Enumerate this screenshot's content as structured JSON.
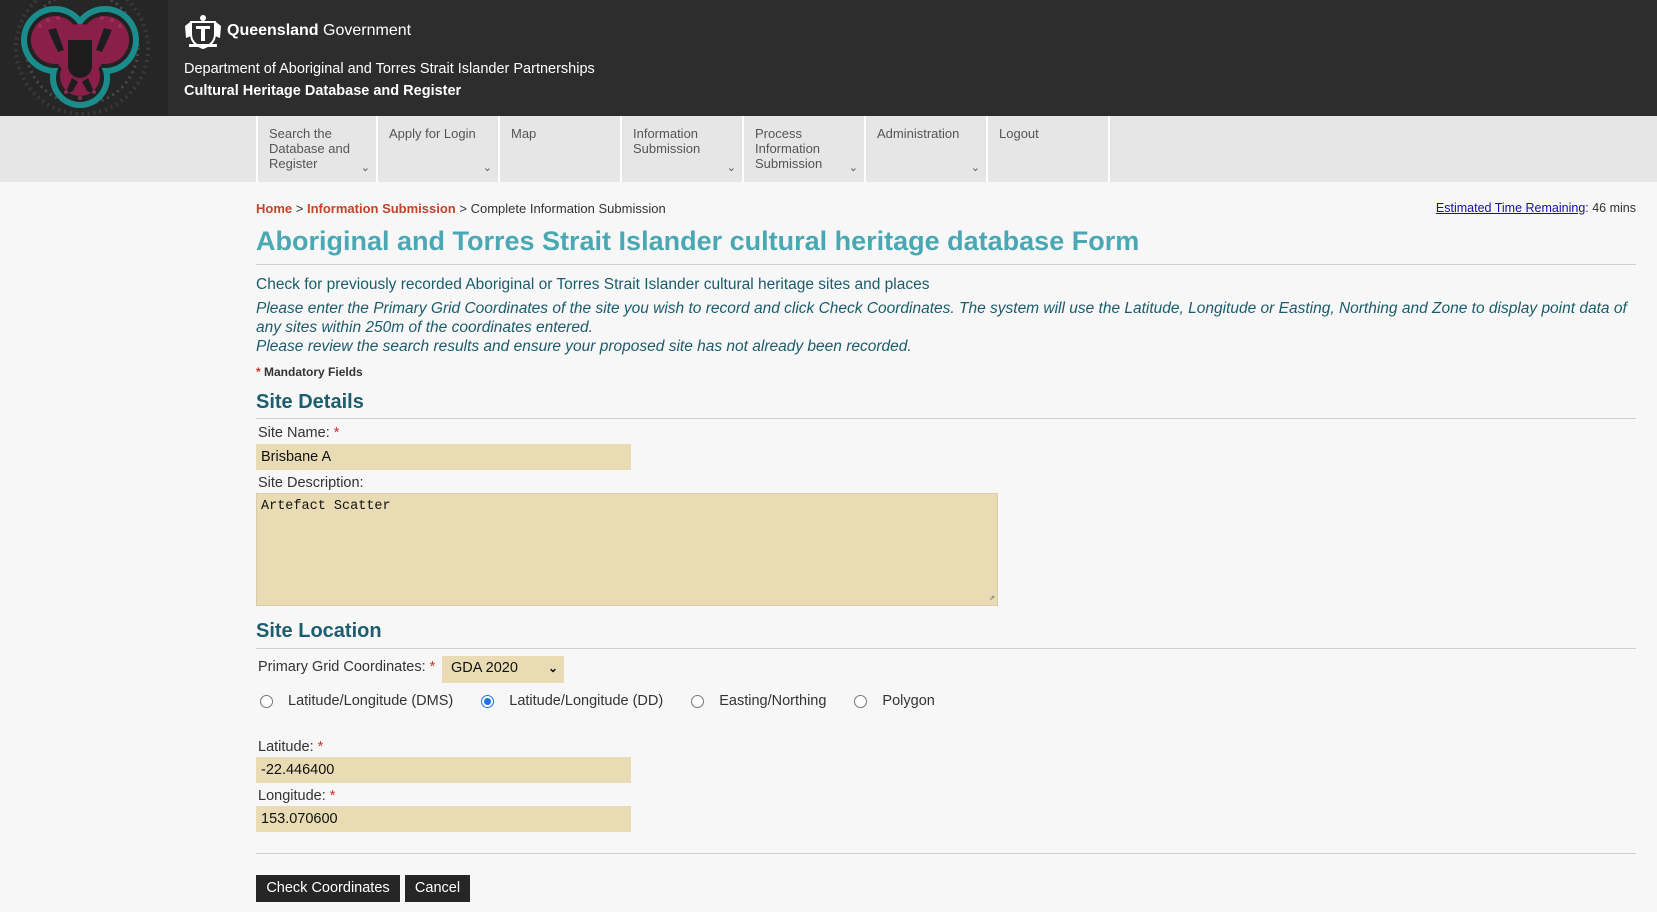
{
  "header": {
    "brand_bold": "Queensland",
    "brand_rest": " Government",
    "department": "Department of Aboriginal and Torres Strait Islander Partnerships",
    "system": "Cultural Heritage Database and Register"
  },
  "nav": {
    "items": [
      {
        "label": "Search the Database and Register"
      },
      {
        "label": "Apply for Login"
      },
      {
        "label": "Map"
      },
      {
        "label": "Information Submission"
      },
      {
        "label": "Process Information Submission"
      },
      {
        "label": "Administration"
      },
      {
        "label": "Logout"
      }
    ]
  },
  "breadcrumb": {
    "home": "Home",
    "sep1": ">",
    "info": "Information Submission",
    "sep2": ">",
    "current": "Complete Information Submission"
  },
  "timer": {
    "link": "Estimated Time Remaining",
    "value": ": 46 mins"
  },
  "page": {
    "title": "Aboriginal and Torres Strait Islander cultural heritage database Form",
    "lead": "Check for previously recorded Aboriginal or Torres Strait Islander cultural heritage sites and places",
    "instruction1": "Please enter the Primary Grid Coordinates of the site you wish to record and click Check Coordinates. The system will use the Latitude, Longitude or Easting, Northing and Zone to display point data of any sites within 250m of the coordinates entered.",
    "instruction2": "Please review the search results and ensure your proposed site has not already been recorded.",
    "mandatory_star": "*",
    "mandatory": "Mandatory Fields"
  },
  "site_details": {
    "heading": "Site Details",
    "name_label": "Site Name:",
    "name_value": "Brisbane A",
    "desc_label": "Site Description:",
    "desc_value": "Artefact Scatter"
  },
  "site_location": {
    "heading": "Site Location",
    "grid_label": "Primary Grid Coordinates:",
    "grid_value": "GDA 2020",
    "radios": [
      {
        "label": "Latitude/Longitude (DMS)",
        "checked": false
      },
      {
        "label": "Latitude/Longitude (DD)",
        "checked": true
      },
      {
        "label": "Easting/Northing",
        "checked": false
      },
      {
        "label": "Polygon",
        "checked": false
      }
    ],
    "lat_label": "Latitude:",
    "lat_value": "-22.446400",
    "lon_label": "Longitude:",
    "lon_value": "153.070600"
  },
  "buttons": {
    "check": "Check Coordinates",
    "cancel": "Cancel"
  },
  "colors": {
    "header_bg": "#2d2d2d",
    "title": "#4aa8b5",
    "section": "#1c5e6e",
    "field_bg": "#e9dcb5",
    "button_bg": "#262626",
    "breadcrumb_link": "#c1442b"
  },
  "icons": [
    "queensland-crest-icon",
    "aboriginal-artwork-logo",
    "chevron-down-icon"
  ]
}
